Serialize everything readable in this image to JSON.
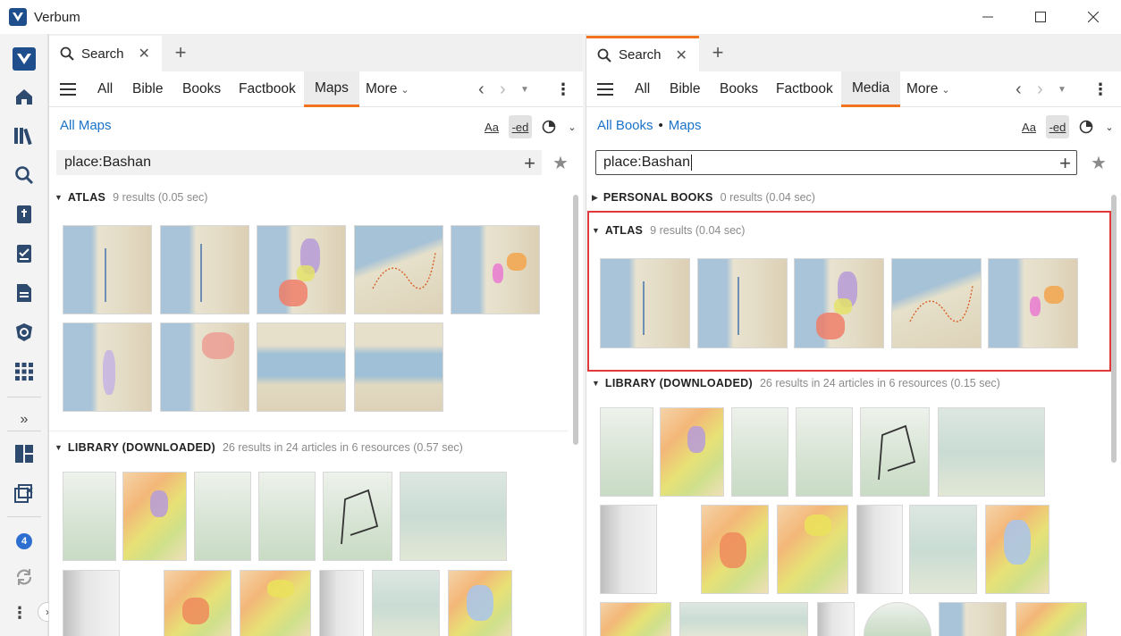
{
  "window": {
    "title": "Verbum",
    "minimize_icon": "minimize-icon",
    "maximize_icon": "maximize-icon",
    "close_icon": "close-icon"
  },
  "colors": {
    "accent": "#f0741e",
    "link": "#1a73c8",
    "highlight": "#e0393c",
    "badge": "#2d6fd1"
  },
  "sidebar": {
    "badge_count": "4"
  },
  "left": {
    "tab_label": "Search",
    "nav": [
      "All",
      "Bible",
      "Books",
      "Factbook",
      "Maps",
      "More"
    ],
    "active_nav": "Maps",
    "breadcrumb": [
      "All Maps"
    ],
    "query": "place:Bashan",
    "sections": [
      {
        "name": "ATLAS",
        "meta": "9 results (0.05 sec)"
      },
      {
        "name": "LIBRARY (DOWNLOADED)",
        "meta": "26 results in 24 articles in 6 resources (0.57 sec)"
      }
    ]
  },
  "right": {
    "tab_label": "Search",
    "nav": [
      "All",
      "Bible",
      "Books",
      "Factbook",
      "Media",
      "More"
    ],
    "active_nav": "Media",
    "breadcrumb": [
      "All Books",
      "Maps"
    ],
    "query": "place:Bashan",
    "sections": [
      {
        "name": "PERSONAL BOOKS",
        "meta": "0 results (0.04 sec)"
      },
      {
        "name": "ATLAS",
        "meta": "9 results (0.04 sec)"
      },
      {
        "name": "LIBRARY (DOWNLOADED)",
        "meta": "26 results in 24 articles in 6 resources (0.15 sec)"
      }
    ]
  },
  "tools": {
    "font": "Aa",
    "ed": "-ed"
  }
}
